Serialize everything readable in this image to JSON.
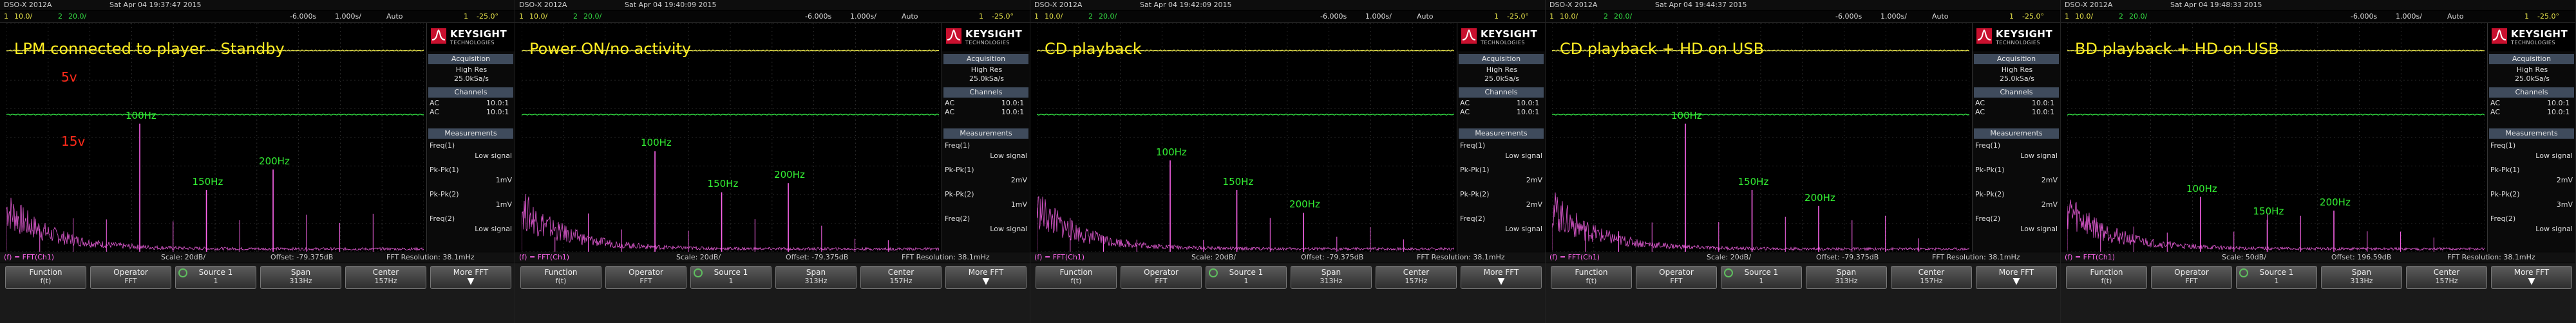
{
  "app": {
    "model": "DSO-X 2012A",
    "brand": "KEYSIGHT",
    "brand_sub": "TECHNOLOGIES"
  },
  "colors": {
    "ch1": "#e6e24a",
    "ch2": "#33dd44",
    "fft": "#ff66ee",
    "annotation": "#ffee22",
    "tag": "#ff2a1a",
    "harmonic": "#33ee33"
  },
  "panels": [
    {
      "header": {
        "model": "DSO-X 2012A",
        "datetime": "Sat Apr 04 19:37:47 2015"
      },
      "status": {
        "ch1_scale": "1",
        "ch1_div": "10.0/",
        "ch2_scale": "2",
        "ch2_div": "20.0/",
        "time_pos": "-6.000s",
        "time_div": "1.000s/",
        "trig_mode": "Auto",
        "trig": "-25.0°",
        "trig_ch": "1"
      },
      "annotation": "LPM connected to player - Standby",
      "tags": [
        "5v",
        "15v"
      ],
      "harmonics": [
        "100Hz",
        "150Hz",
        "200Hz"
      ],
      "peaks": [
        0.56,
        0.27,
        0.36
      ],
      "sidebar": {
        "acq_title": "Acquisition",
        "acq_mode": "High Res",
        "acq_rate": "25.0kSa/s",
        "ch_title": "Channels",
        "ch1_line": {
          "mode": "AC",
          "val": "10.0:1"
        },
        "ch2_line": {
          "mode": "AC",
          "val": "10.0:1"
        },
        "meas_title": "Measurements",
        "m1_label": "Freq(1)",
        "m1_val": "Low signal",
        "m2_label": "Pk-Pk(1)",
        "m2_val": "1mV",
        "m3_label": "Pk-Pk(2)",
        "m3_val": "1mV",
        "m4_label": "Freq(2)",
        "m4_val": "Low signal"
      },
      "fft": {
        "label": "(f) = FFT(Ch1)",
        "scale": "Scale: 20dB/",
        "offset": "Offset: -79.375dB",
        "resolution": "FFT Resolution: 38.1mHz"
      },
      "softkeys": {
        "function": "Function",
        "function_val": "f(t)",
        "operator": "Operator",
        "operator_val": "FFT",
        "source": "Source 1",
        "source_val": "1",
        "span": "Span",
        "span_val": "313Hz",
        "center": "Center",
        "center_val": "157Hz",
        "more": "More FFT"
      }
    },
    {
      "header": {
        "model": "DSO-X 2012A",
        "datetime": "Sat Apr 04 19:40:09 2015"
      },
      "status": {
        "ch1_scale": "1",
        "ch1_div": "10.0/",
        "ch2_scale": "2",
        "ch2_div": "20.0/",
        "time_pos": "-6.000s",
        "time_div": "1.000s/",
        "trig_mode": "Auto",
        "trig": "-25.0°",
        "trig_ch": "1"
      },
      "annotation": "Power ON/no activity",
      "tags": [],
      "harmonics": [
        "100Hz",
        "150Hz",
        "200Hz"
      ],
      "peaks": [
        0.44,
        0.26,
        0.3
      ],
      "sidebar": {
        "acq_title": "Acquisition",
        "acq_mode": "High Res",
        "acq_rate": "25.0kSa/s",
        "ch_title": "Channels",
        "ch1_line": {
          "mode": "AC",
          "val": "10.0:1"
        },
        "ch2_line": {
          "mode": "AC",
          "val": "10.0:1"
        },
        "meas_title": "Measurements",
        "m1_label": "Freq(1)",
        "m1_val": "Low signal",
        "m2_label": "Pk-Pk(1)",
        "m2_val": "2mV",
        "m3_label": "Pk-Pk(2)",
        "m3_val": "1mV",
        "m4_label": "Freq(2)",
        "m4_val": "Low signal"
      },
      "fft": {
        "label": "(f) = FFT(Ch1)",
        "scale": "Scale: 20dB/",
        "offset": "Offset: -79.375dB",
        "resolution": "FFT Resolution: 38.1mHz"
      },
      "softkeys": {
        "function": "Function",
        "function_val": "f(t)",
        "operator": "Operator",
        "operator_val": "FFT",
        "source": "Source 1",
        "source_val": "1",
        "span": "Span",
        "span_val": "313Hz",
        "center": "Center",
        "center_val": "157Hz",
        "more": "More FFT"
      }
    },
    {
      "header": {
        "model": "DSO-X 2012A",
        "datetime": "Sat Apr 04 19:42:09 2015"
      },
      "status": {
        "ch1_scale": "1",
        "ch1_div": "10.0/",
        "ch2_scale": "2",
        "ch2_div": "20.0/",
        "time_pos": "-6.000s",
        "time_div": "1.000s/",
        "trig_mode": "Auto",
        "trig": "-25.0°",
        "trig_ch": "1"
      },
      "annotation": "CD playback",
      "tags": [],
      "harmonics": [
        "100Hz",
        "150Hz",
        "200Hz"
      ],
      "peaks": [
        0.4,
        0.27,
        0.17
      ],
      "sidebar": {
        "acq_title": "Acquisition",
        "acq_mode": "High Res",
        "acq_rate": "25.0kSa/s",
        "ch_title": "Channels",
        "ch1_line": {
          "mode": "AC",
          "val": "10.0:1"
        },
        "ch2_line": {
          "mode": "AC",
          "val": "10.0:1"
        },
        "meas_title": "Measurements",
        "m1_label": "Freq(1)",
        "m1_val": "Low signal",
        "m2_label": "Pk-Pk(1)",
        "m2_val": "2mV",
        "m3_label": "Pk-Pk(2)",
        "m3_val": "2mV",
        "m4_label": "Freq(2)",
        "m4_val": "Low signal"
      },
      "fft": {
        "label": "(f) = FFT(Ch1)",
        "scale": "Scale: 20dB/",
        "offset": "Offset: -79.375dB",
        "resolution": "FFT Resolution: 38.1mHz"
      },
      "softkeys": {
        "function": "Function",
        "function_val": "f(t)",
        "operator": "Operator",
        "operator_val": "FFT",
        "source": "Source 1",
        "source_val": "1",
        "span": "Span",
        "span_val": "313Hz",
        "center": "Center",
        "center_val": "157Hz",
        "more": "More FFT"
      }
    },
    {
      "header": {
        "model": "DSO-X 2012A",
        "datetime": "Sat Apr 04 19:44:37 2015"
      },
      "status": {
        "ch1_scale": "1",
        "ch1_div": "10.0/",
        "ch2_scale": "2",
        "ch2_div": "20.0/",
        "time_pos": "-6.000s",
        "time_div": "1.000s/",
        "trig_mode": "Auto",
        "trig": "-25.0°",
        "trig_ch": "1"
      },
      "annotation": "CD playback + HD on USB",
      "tags": [],
      "harmonics": [
        "100Hz",
        "150Hz",
        "200Hz"
      ],
      "peaks": [
        0.56,
        0.27,
        0.2
      ],
      "sidebar": {
        "acq_title": "Acquisition",
        "acq_mode": "High Res",
        "acq_rate": "25.0kSa/s",
        "ch_title": "Channels",
        "ch1_line": {
          "mode": "AC",
          "val": "10.0:1"
        },
        "ch2_line": {
          "mode": "AC",
          "val": "10.0:1"
        },
        "meas_title": "Measurements",
        "m1_label": "Freq(1)",
        "m1_val": "Low signal",
        "m2_label": "Pk-Pk(1)",
        "m2_val": "2mV",
        "m3_label": "Pk-Pk(2)",
        "m3_val": "2mV",
        "m4_label": "Freq(2)",
        "m4_val": "Low signal"
      },
      "fft": {
        "label": "(f) = FFT(Ch1)",
        "scale": "Scale: 20dB/",
        "offset": "Offset: -79.375dB",
        "resolution": "FFT Resolution: 38.1mHz"
      },
      "softkeys": {
        "function": "Function",
        "function_val": "f(t)",
        "operator": "Operator",
        "operator_val": "FFT",
        "source": "Source 1",
        "source_val": "1",
        "span": "Span",
        "span_val": "313Hz",
        "center": "Center",
        "center_val": "157Hz",
        "more": "More FFT"
      }
    },
    {
      "header": {
        "model": "DSO-X 2012A",
        "datetime": "Sat Apr 04 19:48:33 2015"
      },
      "status": {
        "ch1_scale": "1",
        "ch1_div": "10.0/",
        "ch2_scale": "2",
        "ch2_div": "20.0/",
        "time_pos": "-6.000s",
        "time_div": "1.000s/",
        "trig_mode": "Auto",
        "trig": "-25.0°",
        "trig_ch": "1"
      },
      "annotation": "BD playback + HD on USB",
      "tags": [],
      "harmonics": [
        "100Hz",
        "150Hz",
        "200Hz"
      ],
      "peaks": [
        0.24,
        0.14,
        0.18
      ],
      "sidebar": {
        "acq_title": "Acquisition",
        "acq_mode": "High Res",
        "acq_rate": "25.0kSa/s",
        "ch_title": "Channels",
        "ch1_line": {
          "mode": "AC",
          "val": "10.0:1"
        },
        "ch2_line": {
          "mode": "AC",
          "val": "10.0:1"
        },
        "meas_title": "Measurements",
        "m1_label": "Freq(1)",
        "m1_val": "Low signal",
        "m2_label": "Pk-Pk(1)",
        "m2_val": "2mV",
        "m3_label": "Pk-Pk(2)",
        "m3_val": "3mV",
        "m4_label": "Freq(2)",
        "m4_val": "Low signal"
      },
      "fft": {
        "label": "(f) = FFT(Ch1)",
        "scale": "Scale: 50dB/",
        "offset": "Offset: 196.59dB",
        "resolution": "FFT Resolution: 38.1mHz"
      },
      "softkeys": {
        "function": "Function",
        "function_val": "f(t)",
        "operator": "Operator",
        "operator_val": "FFT",
        "source": "Source 1",
        "source_val": "1",
        "span": "Span",
        "span_val": "313Hz",
        "center": "Center",
        "center_val": "157Hz",
        "more": "More FFT"
      }
    }
  ]
}
